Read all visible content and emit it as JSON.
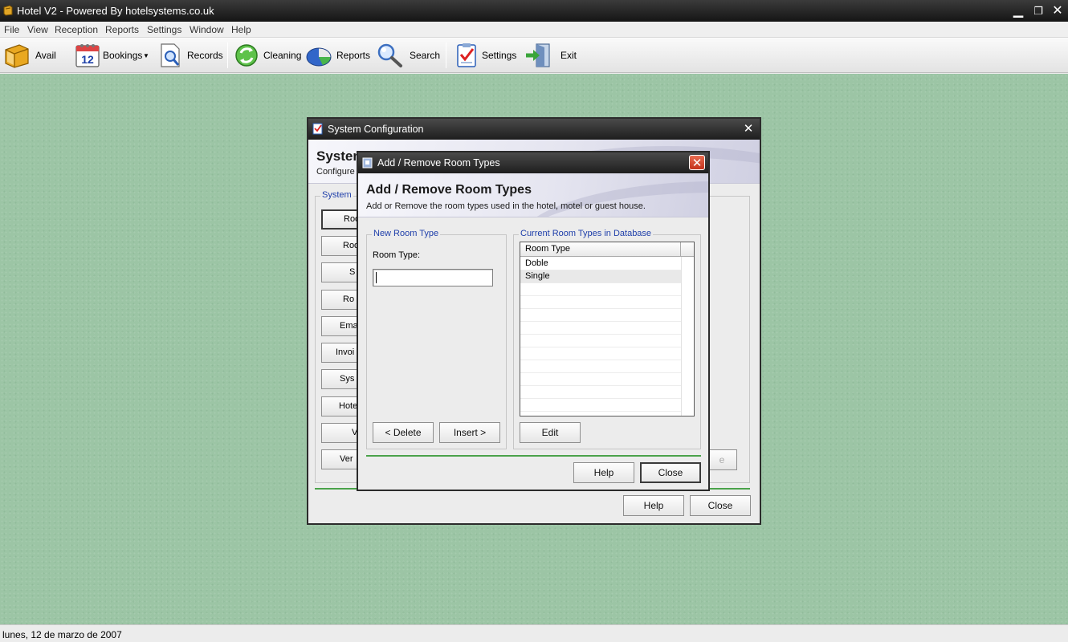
{
  "app": {
    "title": "Hotel V2 - Powered By hotelsystems.co.uk",
    "status_date": "lunes, 12 de marzo de 2007"
  },
  "menu": [
    "File",
    "View",
    "Reception",
    "Reports",
    "Settings",
    "Window",
    "Help"
  ],
  "toolbar": {
    "avail": "Avail",
    "bookings": "Bookings",
    "records": "Records",
    "cleaning": "Cleaning",
    "reports": "Reports",
    "search": "Search",
    "settings": "Settings",
    "exit": "Exit",
    "bookings_icon_text": "12"
  },
  "system_config": {
    "title": "System Configuration",
    "header": "System",
    "subheader": "Configure",
    "group_label": "System",
    "buttons": [
      "Roo",
      "Roo",
      "S",
      "Ro",
      "Ema",
      "Invoi",
      "Sys",
      "Hote",
      "V",
      "Ver"
    ],
    "partial_button": "e",
    "help": "Help",
    "close": "Close"
  },
  "room_types": {
    "title": "Add / Remove Room Types",
    "header": "Add / Remove Room Types",
    "subheader": "Add or Remove the room types used in the hotel, motel or guest house.",
    "new_group": "New Room Type",
    "room_type_label": "Room Type:",
    "room_type_value": "",
    "current_group": "Current Room Types in Database",
    "column_header": "Room Type",
    "rows": [
      "Doble",
      "Single"
    ],
    "delete": "< Delete",
    "insert": "Insert >",
    "edit": "Edit",
    "help": "Help",
    "close": "Close"
  },
  "colors": {
    "desktop": "#9cc5a5",
    "accent_label": "#1f3faa",
    "close_red": "#d9452e"
  }
}
